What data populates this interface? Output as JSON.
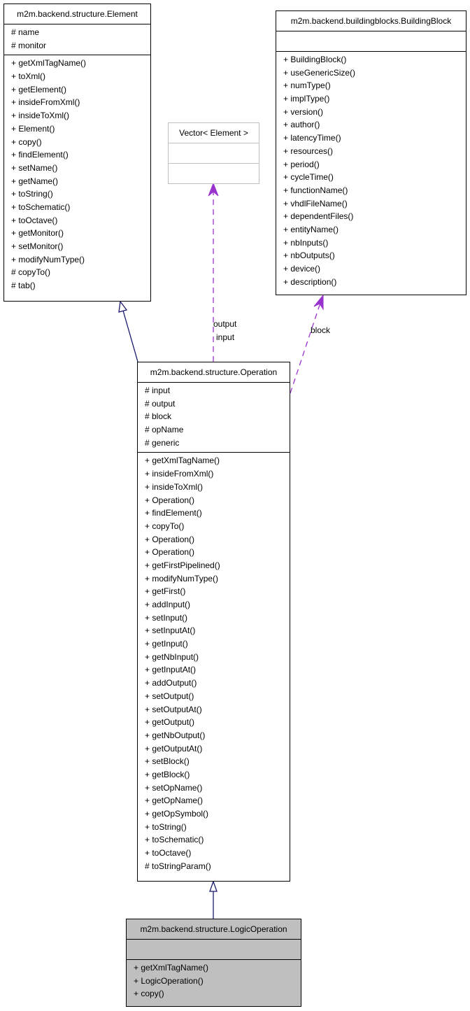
{
  "classes": {
    "element": {
      "name": "m2m.backend.structure.Element",
      "attributes": [
        "# name",
        "# monitor"
      ],
      "methods": [
        "+ getXmlTagName()",
        "+ toXml()",
        "+ getElement()",
        "+ insideFromXml()",
        "+ insideToXml()",
        "+ Element()",
        "+ copy()",
        "+ findElement()",
        "+ setName()",
        "+ getName()",
        "+ toString()",
        "+ toSchematic()",
        "+ toOctave()",
        "+ getMonitor()",
        "+ setMonitor()",
        "+ modifyNumType()",
        "# copyTo()",
        "# tab()"
      ]
    },
    "vector": {
      "name": "Vector< Element >",
      "attributes": [],
      "methods": []
    },
    "building_block": {
      "name": "m2m.backend.buildingblocks.BuildingBlock",
      "attributes": [],
      "methods": [
        "+ BuildingBlock()",
        "+ useGenericSize()",
        "+ numType()",
        "+ implType()",
        "+ version()",
        "+ author()",
        "+ latencyTime()",
        "+ resources()",
        "+ period()",
        "+ cycleTime()",
        "+ functionName()",
        "+ vhdlFileName()",
        "+ dependentFiles()",
        "+ entityName()",
        "+ nbInputs()",
        "+ nbOutputs()",
        "+ device()",
        "+ description()"
      ]
    },
    "operation": {
      "name": "m2m.backend.structure.Operation",
      "attributes": [
        "# input",
        "# output",
        "# block",
        "# opName",
        "# generic"
      ],
      "methods": [
        "+ getXmlTagName()",
        "+ insideFromXml()",
        "+ insideToXml()",
        "+ Operation()",
        "+ findElement()",
        "+ copyTo()",
        "+ Operation()",
        "+ Operation()",
        "+ getFirstPipelined()",
        "+ modifyNumType()",
        "+ getFirst()",
        "+ addInput()",
        "+ setInput()",
        "+ setInputAt()",
        "+ getInput()",
        "+ getNbInput()",
        "+ getInputAt()",
        "+ addOutput()",
        "+ setOutput()",
        "+ setOutputAt()",
        "+ getOutput()",
        "+ getNbOutput()",
        "+ getOutputAt()",
        "+ setBlock()",
        "+ getBlock()",
        "+ setOpName()",
        "+ getOpName()",
        "+ getOpSymbol()",
        "+ toString()",
        "+ toSchematic()",
        "+ toOctave()",
        "# toStringParam()"
      ]
    },
    "logic_operation": {
      "name": "m2m.backend.structure.LogicOperation",
      "attributes": [],
      "methods": [
        "+ getXmlTagName()",
        "+ LogicOperation()",
        "+ copy()"
      ]
    }
  },
  "edges": {
    "usage_vector_label_1": "output",
    "usage_vector_label_2": "input",
    "usage_block_label": "block"
  },
  "colors": {
    "inheritance": "#191970",
    "usage": "#9a32cd",
    "focus_fill": "#bfbfbf",
    "external_border": "#bfbfbf"
  }
}
